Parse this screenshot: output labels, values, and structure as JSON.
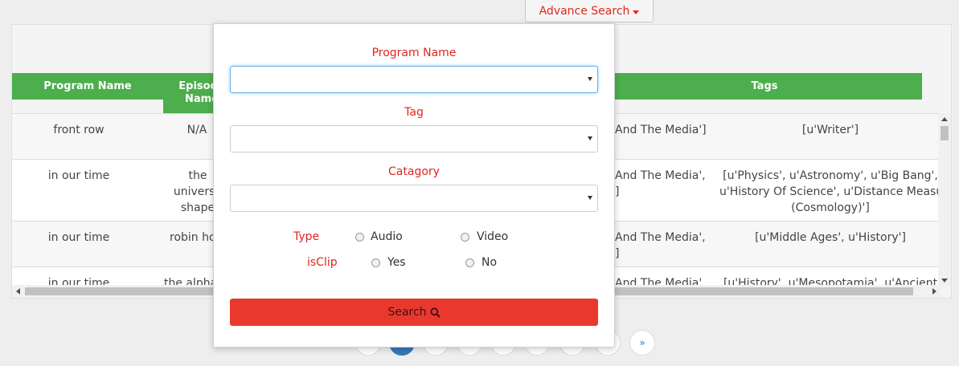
{
  "advance_search": {
    "label": "Advance Search"
  },
  "table": {
    "headers": [
      {
        "label": "Program Name"
      },
      {
        "label": "Episode Name"
      },
      {
        "label": "Tags"
      }
    ],
    "rows": [
      {
        "program": "front row",
        "episode": [
          "N/A"
        ],
        "category": [
          "And The Media']"
        ],
        "tags": [
          "[u'Writer']"
        ]
      },
      {
        "program": "in our time",
        "episode": [
          "the",
          "universe",
          "shape"
        ],
        "category": [
          "And The Media',",
          "]"
        ],
        "tags": [
          "[u'Physics', u'Astronomy', u'Big Bang',",
          "u'History Of Science', u'Distance Measures",
          "(Cosmology)']"
        ]
      },
      {
        "program": "in our time",
        "episode": [
          "robin hoo"
        ],
        "category": [
          "And The Media',",
          "]"
        ],
        "tags": [
          "[u'Middle Ages', u'History']"
        ]
      },
      {
        "program": "in our time",
        "episode": [
          "the alpha"
        ],
        "category": [
          "And The Media',"
        ],
        "tags": [
          "[u'History', u'Mesopotamia', u'Ancient"
        ]
      }
    ]
  },
  "pagination": {
    "next": "»"
  },
  "form": {
    "program_name": {
      "label": "Program Name",
      "value": ""
    },
    "tag": {
      "label": "Tag",
      "value": ""
    },
    "category": {
      "label": "Catagory",
      "value": ""
    },
    "type": {
      "label": "Type",
      "options": [
        "Audio",
        "Video"
      ]
    },
    "isclip": {
      "label": "isClip",
      "options": [
        "Yes",
        "No"
      ]
    },
    "search": {
      "label": "Search"
    }
  },
  "colors": {
    "accent_red": "#e0261b",
    "header_green": "#4cae4c",
    "button_red": "#e9392f",
    "page_active": "#337ab7"
  }
}
